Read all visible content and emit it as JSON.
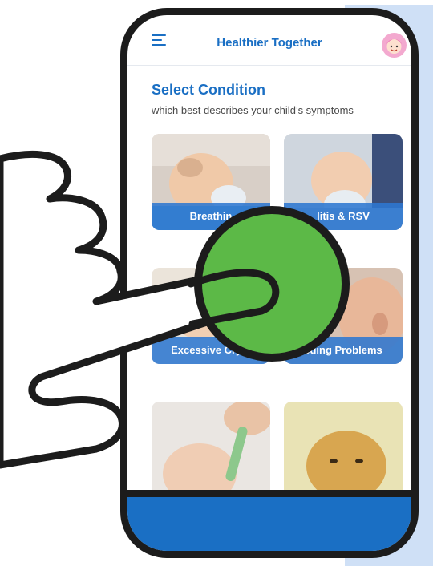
{
  "header": {
    "app_title": "Healthier Together",
    "menu_icon": "hamburger-menu-icon",
    "avatar_icon": "cartoon-face-avatar-icon"
  },
  "main": {
    "title": "Select Condition",
    "subtitle": "which best describes your child’s symptoms"
  },
  "conditions": [
    {
      "label": "Breathing Difficulties",
      "visible_label": "Breathin",
      "image": "baby-with-mask-photo"
    },
    {
      "label": "Bronchiolitis & RSV",
      "visible_label": "litis & RSV",
      "image": "baby-with-nebulizer-photo"
    },
    {
      "label": "Excessive Crying",
      "visible_label": "Excessive Cryin",
      "image": "crying-baby-photo"
    },
    {
      "label": "Feeding Problems",
      "visible_label": "eding Problems",
      "image": "baby-ear-closeup-photo"
    },
    {
      "label": "",
      "image": "baby-thermometer-photo"
    },
    {
      "label": "",
      "image": "jaundice-baby-photo"
    }
  ],
  "overlay": {
    "hand_icon": "pointing-hand-icon",
    "tap_icon": "green-tap-circle-icon"
  },
  "colors": {
    "brand_blue": "#1a6fc4",
    "tap_green": "#5cb947",
    "outline": "#1c1c1c",
    "background_panel": "#cfe0f6"
  }
}
